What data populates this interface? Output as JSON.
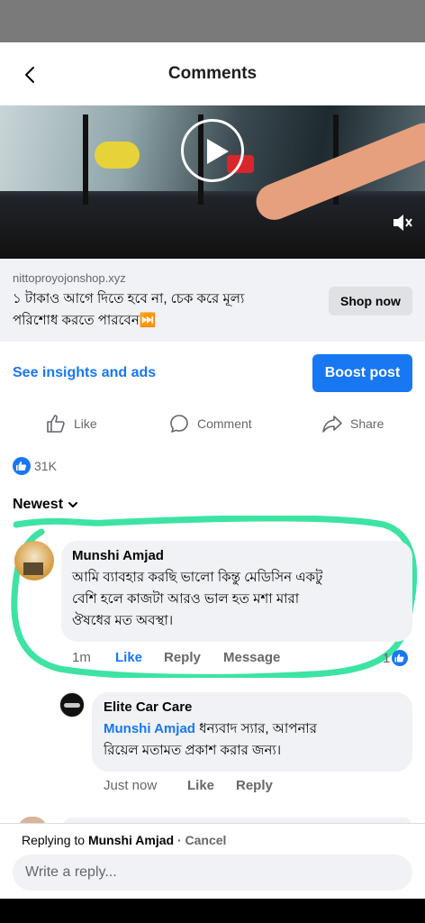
{
  "header": {
    "title": "Comments"
  },
  "ad": {
    "domain": "nittoproyojonshop.xyz",
    "text_line1": "১ টাকাও আগে দিতে হবে না, চেক করে মূল্য",
    "text_line2": "পরিশোধ করতে পারবেন⏭️",
    "cta_label": "Shop now"
  },
  "insights": {
    "link_label": "See insights and ads",
    "boost_label": "Boost post"
  },
  "actions": {
    "like_label": "Like",
    "comment_label": "Comment",
    "share_label": "Share"
  },
  "reactions": {
    "count": "31K"
  },
  "sort": {
    "label": "Newest"
  },
  "comment": {
    "author": "Munshi Amjad",
    "line1": "আমি ব্যাবহার করছি ভালো কিন্তু মেডিসিন একটু",
    "line2": "বেশি হলে কাজটা আরও ভাল হত মশা মারা",
    "line3": "ঔষধের মত অবস্থা।",
    "time": "1m",
    "like_label": "Like",
    "reply_label": "Reply",
    "message_label": "Message",
    "like_count": "1"
  },
  "reply": {
    "author": "Elite Car Care",
    "mention": "Munshi Amjad",
    "line1_rest": " ধন্যবাদ স্যার, আপনার",
    "line2": "রিয়েল মতামত প্রকাশ করার জন্য।",
    "time": "Just now",
    "like_label": "Like",
    "reply_label": "Reply"
  },
  "composer": {
    "replying_prefix": "Replying to ",
    "replying_name": "Munshi Amjad",
    "cancel_label": " · Cancel",
    "placeholder": "Write a reply..."
  },
  "colors": {
    "accent": "#1877f2",
    "highlight": "#3de3a3",
    "bubble": "#f0f2f5"
  }
}
